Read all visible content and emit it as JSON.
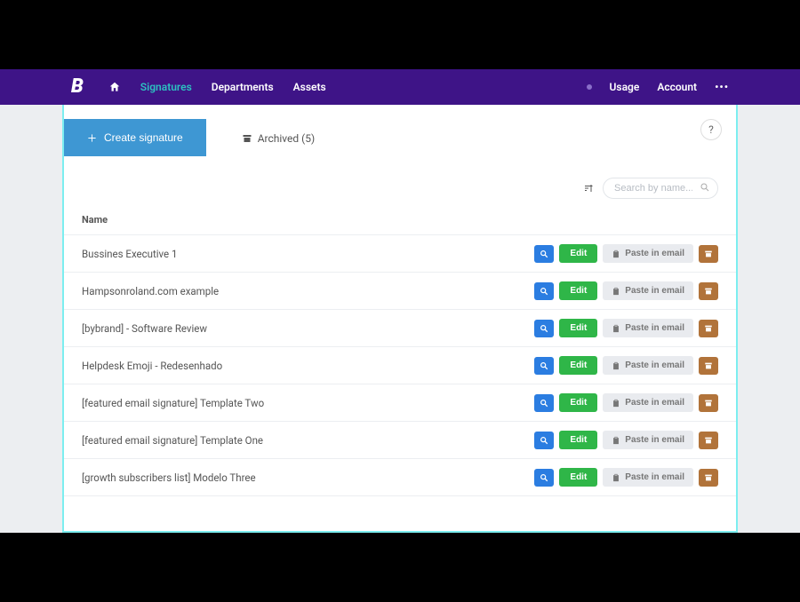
{
  "brand": "B",
  "nav": {
    "signatures": "Signatures",
    "departments": "Departments",
    "assets": "Assets",
    "usage": "Usage",
    "account": "Account"
  },
  "buttons": {
    "create": "Create signature",
    "archived": "Archived (5)",
    "help": "?",
    "edit": "Edit",
    "paste": "Paste in email"
  },
  "search": {
    "placeholder": "Search by name..."
  },
  "table": {
    "header_name": "Name"
  },
  "rows": [
    {
      "name": "Bussines Executive 1"
    },
    {
      "name": "Hampsonroland.com example"
    },
    {
      "name": "[bybrand] - Software Review"
    },
    {
      "name": "Helpdesk Emoji - Redesenhado"
    },
    {
      "name": "[featured email signature] Template Two"
    },
    {
      "name": "[featured email signature] Template One"
    },
    {
      "name": "[growth subscribers list] Modelo Three"
    }
  ]
}
